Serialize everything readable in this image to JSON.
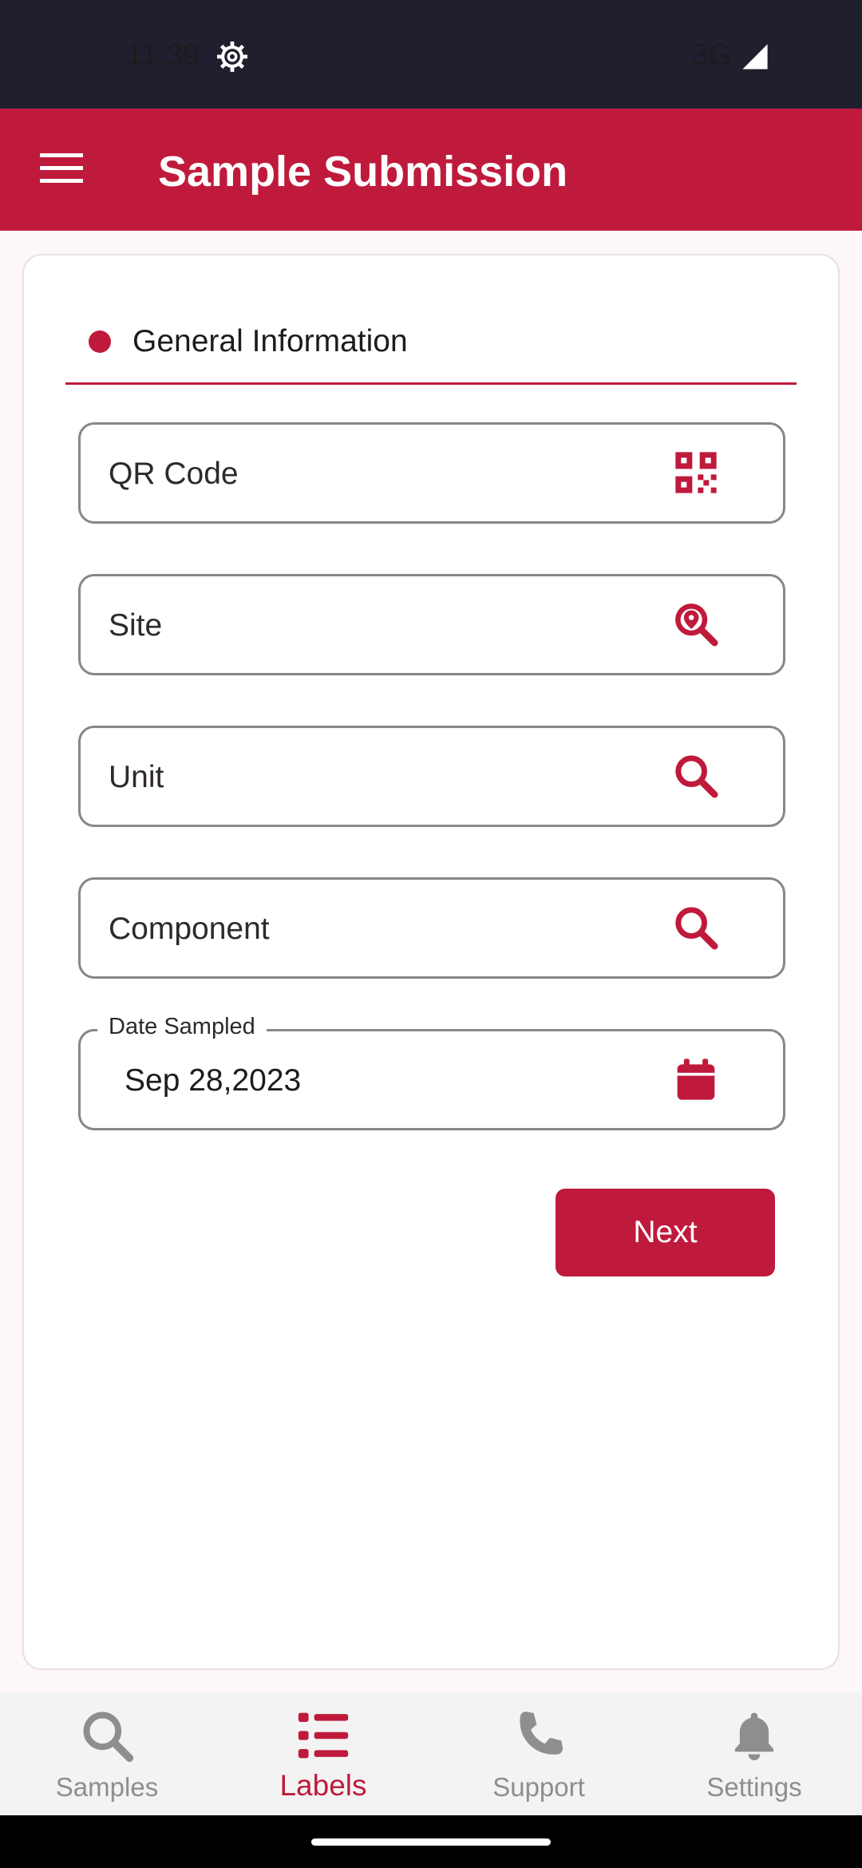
{
  "status_bar": {
    "time": "11:39",
    "network": "3G"
  },
  "app_bar": {
    "title": "Sample Submission"
  },
  "section": {
    "title": "General Information"
  },
  "fields": [
    {
      "label": "QR Code",
      "icon": "qr-code-icon"
    },
    {
      "label": "Site",
      "icon": "location-search-icon"
    },
    {
      "label": "Unit",
      "icon": "search-icon"
    },
    {
      "label": "Component",
      "icon": "search-icon"
    }
  ],
  "date_field": {
    "caption": "Date Sampled",
    "value": "Sep 28,2023",
    "icon": "calendar-icon"
  },
  "next_button": {
    "label": "Next"
  },
  "bottom_nav": {
    "active": "Labels",
    "items": [
      {
        "label": "Samples",
        "icon": "search-icon"
      },
      {
        "label": "Labels",
        "icon": "list-icon"
      },
      {
        "label": "Support",
        "icon": "phone-icon"
      },
      {
        "label": "Settings",
        "icon": "bell-icon"
      }
    ]
  },
  "colors": {
    "brand": "#bf1a3c",
    "status_bar": "#1f1f2e",
    "inactive_nav": "#8e8e8e"
  }
}
